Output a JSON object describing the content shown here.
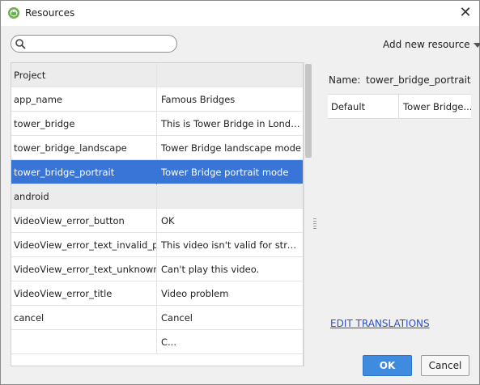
{
  "window": {
    "title": "Resources"
  },
  "toolbar": {
    "search_placeholder": "",
    "search_value": "",
    "add_resource_label": "Add new resource"
  },
  "resources": {
    "rows": [
      {
        "type": "group",
        "key": "Project",
        "value": ""
      },
      {
        "type": "item",
        "key": "app_name",
        "value": "Famous Bridges"
      },
      {
        "type": "item",
        "key": "tower_bridge",
        "value": "This is Tower Bridge in Londo..."
      },
      {
        "type": "item",
        "key": "tower_bridge_landscape",
        "value": "Tower Bridge landscape mode"
      },
      {
        "type": "selected",
        "key": "tower_bridge_portrait",
        "value": "Tower Bridge portrait mode"
      },
      {
        "type": "group",
        "key": "android",
        "value": ""
      },
      {
        "type": "item",
        "key": "VideoView_error_button",
        "value": "OK"
      },
      {
        "type": "item",
        "key": "VideoView_error_text_invalid_prog",
        "value": "This video isn't valid for strea..."
      },
      {
        "type": "item",
        "key": "VideoView_error_text_unknown",
        "value": "Can't play this video."
      },
      {
        "type": "item",
        "key": "VideoView_error_title",
        "value": "Video problem"
      },
      {
        "type": "item",
        "key": "cancel",
        "value": "Cancel"
      },
      {
        "type": "item",
        "key": "",
        "value": "C..."
      }
    ]
  },
  "details": {
    "name_label": "Name:",
    "name_value": "tower_bridge_portrait",
    "locale": "Default",
    "value": "Tower Bridge...",
    "edit_translations": "EDIT TRANSLATIONS"
  },
  "buttons": {
    "ok": "OK",
    "cancel": "Cancel"
  },
  "colors": {
    "selection": "#3875d7",
    "accent": "#3e8be0",
    "link": "#2a50c8"
  }
}
